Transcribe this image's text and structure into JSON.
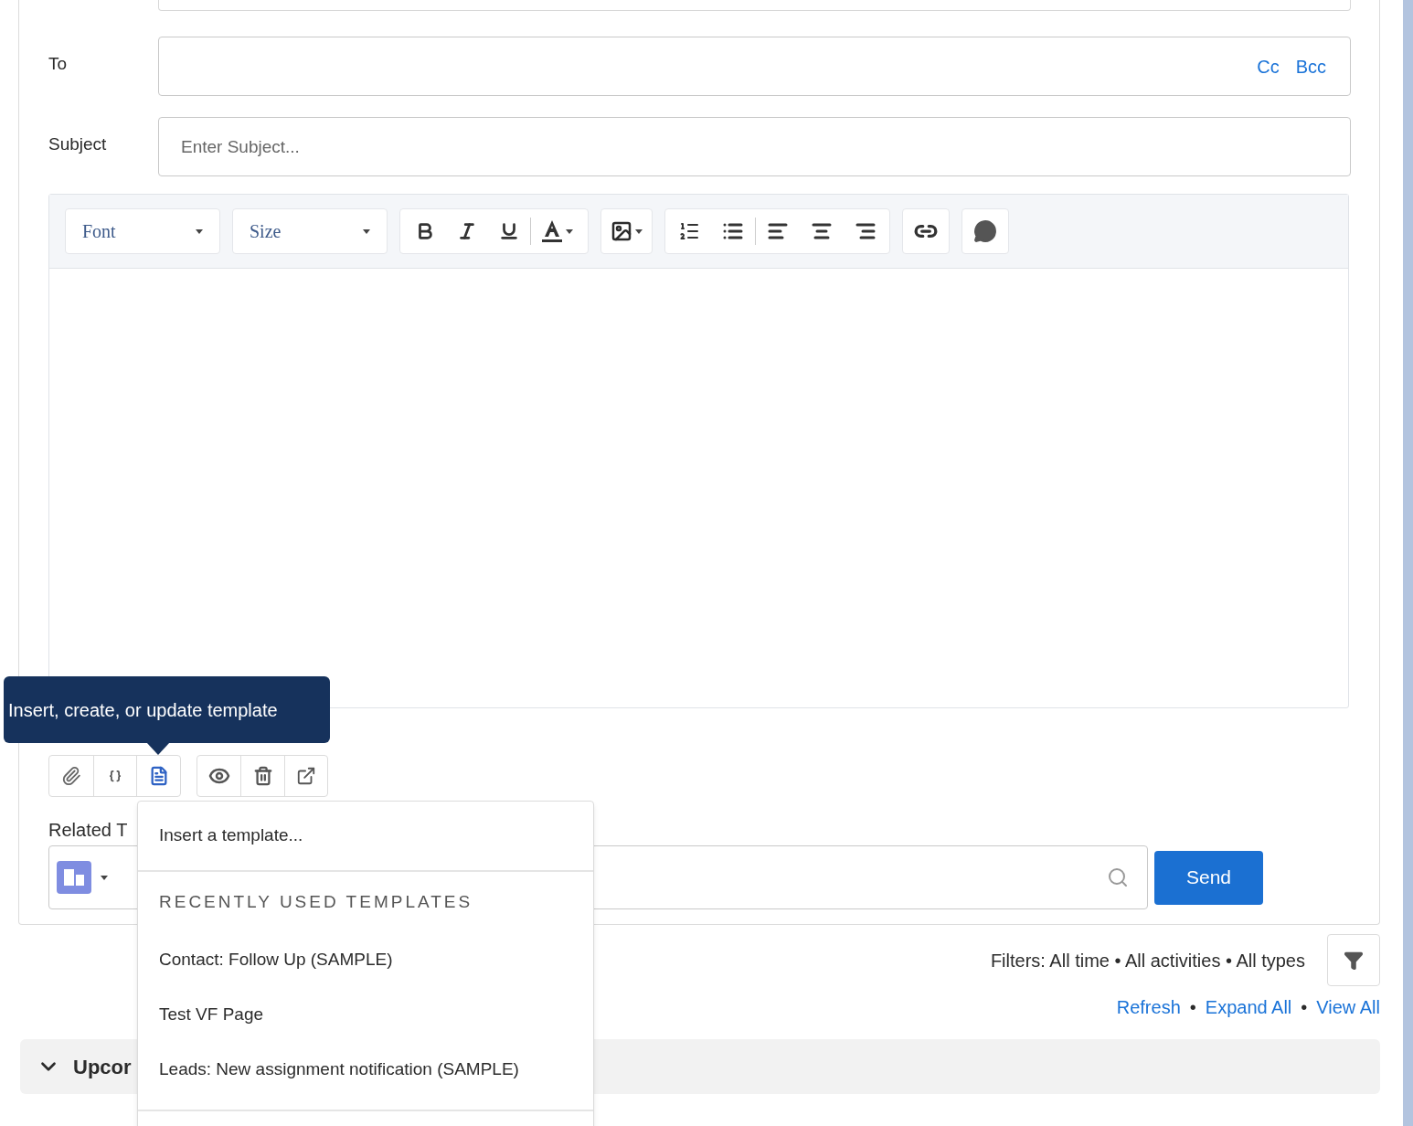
{
  "compose": {
    "to": {
      "label": "To",
      "cc": "Cc",
      "bcc": "Bcc"
    },
    "subject": {
      "label": "Subject",
      "placeholder": "Enter Subject..."
    },
    "toolbar": {
      "font": "Font",
      "size": "Size"
    },
    "tooltip": "Insert, create, or update template",
    "related": {
      "label": "Related T"
    },
    "send": "Send"
  },
  "template_menu": {
    "insert": "Insert a template...",
    "header": "RECENTLY USED TEMPLATES",
    "items": [
      {
        "label": "Contact: Follow Up (SAMPLE)"
      },
      {
        "label": "Test VF Page"
      },
      {
        "label": "Leads: New assignment notification (SAMPLE)"
      }
    ]
  },
  "activity": {
    "filters": "Filters: All time • All activities • All types",
    "links": [
      {
        "label": "Refresh"
      },
      {
        "label": "Expand All"
      },
      {
        "label": "View All"
      }
    ],
    "separators": [
      "•",
      "•"
    ],
    "section": {
      "label": "Upcor",
      "expanded": true
    }
  }
}
